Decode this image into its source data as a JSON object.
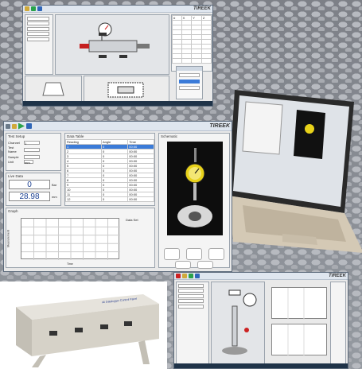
{
  "brand_logo": "TIREEK",
  "main_window": {
    "setup_panel_title": "Test Setup",
    "fields": [
      {
        "label": "Channel",
        "value": "1"
      },
      {
        "label": "Test Name",
        "value": ""
      },
      {
        "label": "Sample",
        "value": ""
      },
      {
        "label": "Unit",
        "value": "mm"
      }
    ],
    "live_panel_title": "Live Data",
    "reading_1": "0",
    "reading_2": "28.98",
    "units_1": "Bar",
    "units_2": "mm",
    "table_panel_title": "Data Table",
    "table_headers": [
      "Reading",
      "Angle",
      "Time"
    ],
    "table_rows": [
      [
        "1",
        "0",
        "00:00"
      ],
      [
        "2",
        "0",
        "00:00"
      ],
      [
        "3",
        "0",
        "00:00"
      ],
      [
        "4",
        "0",
        "00:00"
      ],
      [
        "5",
        "0",
        "00:00"
      ],
      [
        "6",
        "0",
        "00:00"
      ],
      [
        "7",
        "0",
        "00:00"
      ],
      [
        "8",
        "0",
        "00:00"
      ],
      [
        "9",
        "0",
        "00:00"
      ],
      [
        "10",
        "0",
        "00:00"
      ],
      [
        "11",
        "0",
        "00:00"
      ],
      [
        "12",
        "0",
        "00:00"
      ]
    ],
    "graph_panel_title": "Graph",
    "graph_legend": "Data Set",
    "graph_ylabel": "Measurement",
    "graph_xlabel": "Time",
    "schematic_panel_title": "Schematic"
  },
  "device_label": "Ali Datalogger Control Panel",
  "top_window": {
    "table_headers": [
      "#",
      "X",
      "Y",
      "Z"
    ]
  },
  "colors": {
    "accent_blue": "#1a3f91",
    "selection": "#3b7bd8",
    "dial_yellow": "#e8d21a"
  }
}
